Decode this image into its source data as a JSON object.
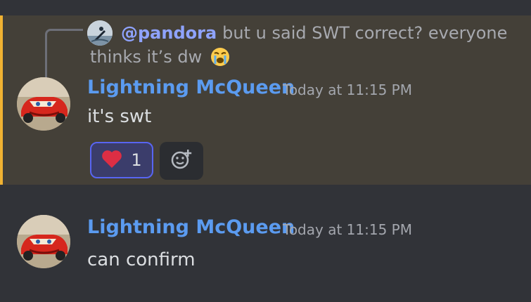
{
  "messages": [
    {
      "reply": {
        "mention": "@pandora",
        "line1": "but u said SWT correct? everyone",
        "line2": "thinks it’s dw",
        "emoji": "loudly-crying-face"
      },
      "username": "Lightning McQueen",
      "timestamp": "Today at 11:15 PM",
      "content": "it's swt",
      "highlighted": true,
      "reactions": [
        {
          "emoji": "red-heart",
          "count": "1",
          "selected": true
        }
      ]
    },
    {
      "username": "Lightning McQueen",
      "timestamp": "Today at 11:15 PM",
      "content": "can confirm",
      "highlighted": false
    }
  ],
  "colors": {
    "background": "#313338",
    "highlight_background": "#444038",
    "highlight_bar": "#f0b232",
    "username": "#5b9bf0",
    "mention": "#8fa3ff",
    "reaction_border": "#5865f2"
  },
  "icons": {
    "add_reaction": "add-reaction-smiley-icon",
    "reply_spine": "reply-connector-icon"
  }
}
